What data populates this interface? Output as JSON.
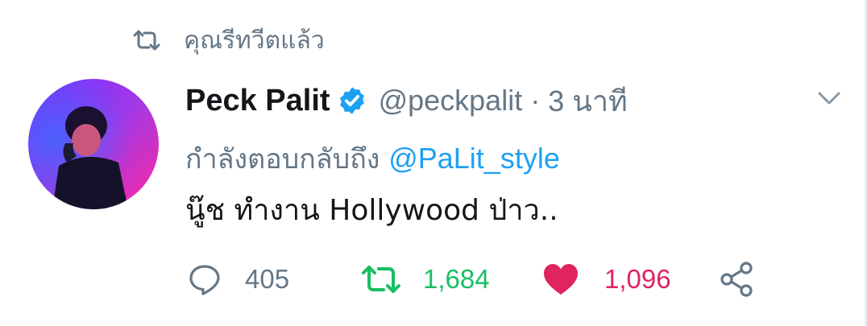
{
  "retweet_context": {
    "icon": "retweet-icon",
    "text": "คุณรีทวีตแล้ว"
  },
  "tweet": {
    "avatar": "avatar-photo",
    "display_name": "Peck Palit",
    "verified": true,
    "handle": "@peckpalit",
    "separator": "·",
    "time": "3 นาที",
    "reply_prefix": "กำลังตอบกลับถึง",
    "reply_to": "@PaLit_style",
    "text": "นู๊ช ทำงาน Hollywood ป่าว.."
  },
  "actions": {
    "reply_count": "405",
    "retweet_count": "1,684",
    "like_count": "1,096",
    "retweeted": true,
    "liked": true
  },
  "colors": {
    "secondary_text": "#657786",
    "primary_text": "#14171a",
    "link": "#1da1f2",
    "retweet_active": "#17bf63",
    "like_active": "#e0245e"
  }
}
